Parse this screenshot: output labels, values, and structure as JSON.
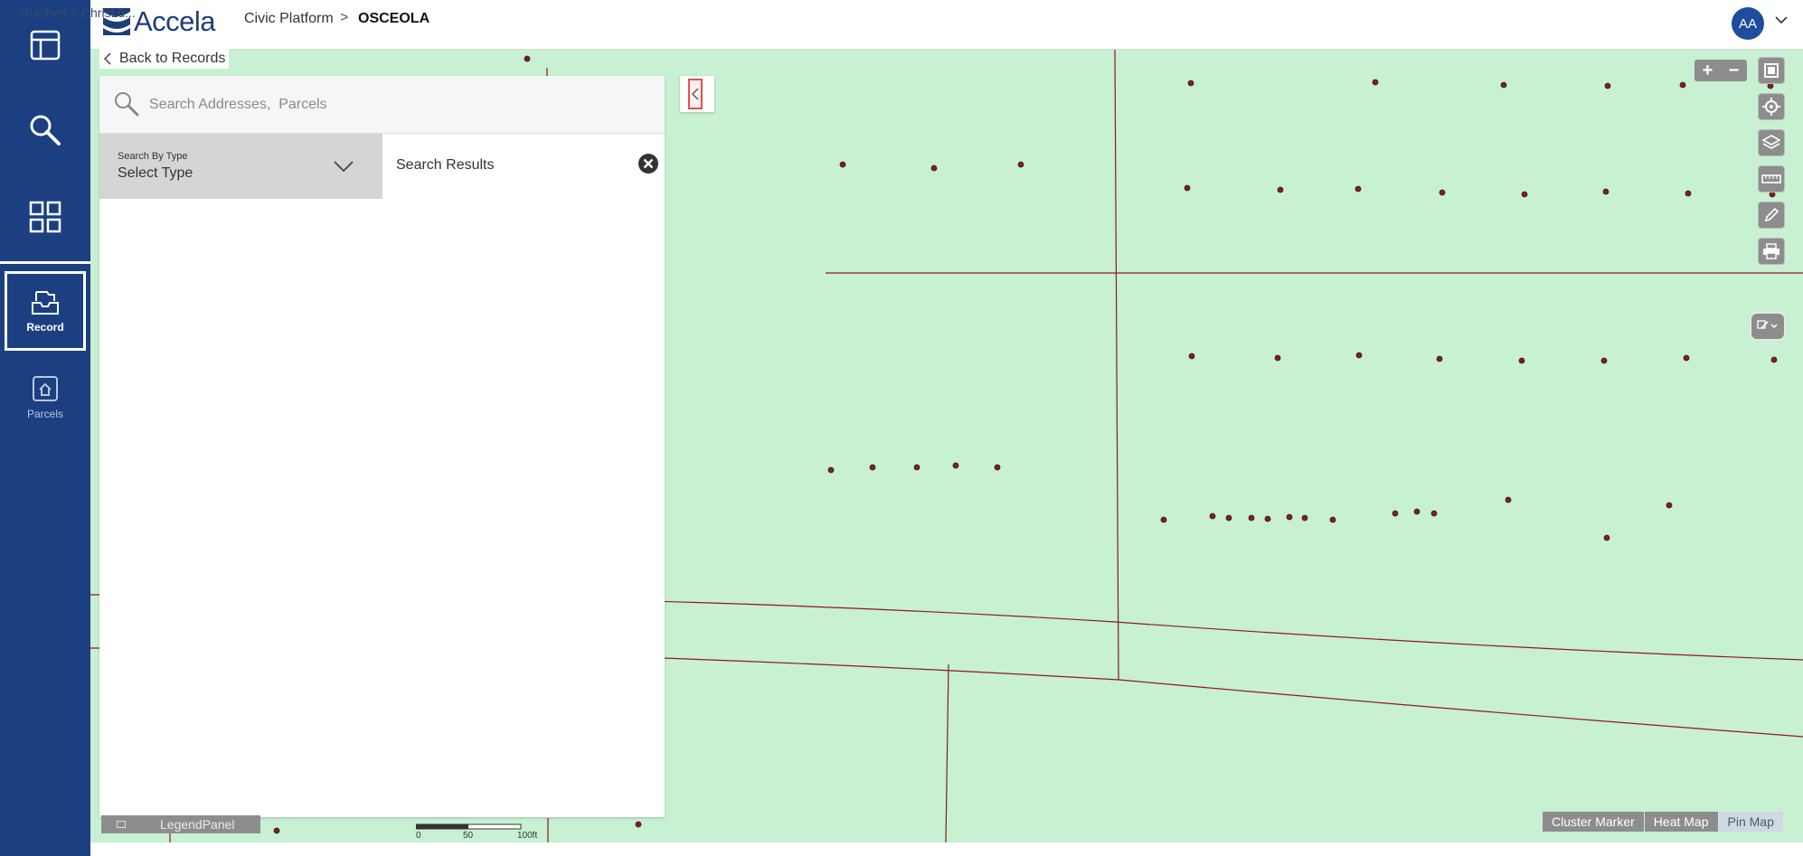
{
  "header": {
    "logo_text": "Accela",
    "breadcrumb_root": "Civic Platform",
    "breadcrumb_sep": ">",
    "breadcrumb_current": "OSCEOLA",
    "avatar_initials": "AA",
    "ghost_breadcrumb": "TruChen > ChrisLu..."
  },
  "leftnav": {
    "items": [
      {
        "name": "dashboard",
        "icon": "layout-icon",
        "label": ""
      },
      {
        "name": "search",
        "icon": "search-icon",
        "label": ""
      },
      {
        "name": "apps",
        "icon": "grid-icon",
        "label": ""
      },
      {
        "name": "record",
        "icon": "inbox-icon",
        "label": "Record"
      },
      {
        "name": "parcels",
        "icon": "parcel-icon",
        "label": "Parcels"
      }
    ]
  },
  "back_link": "Back to Records",
  "search": {
    "placeholder": "Search Addresses,  Parcels",
    "value": "",
    "type_small_label": "Search By Type",
    "type_value": "Select Type",
    "results_label": "Search Results"
  },
  "bottom": {
    "legend_label": "LegendPanel",
    "scale_ticks": [
      "0",
      "50",
      "100ft"
    ],
    "modes": [
      {
        "label": "Cluster Marker",
        "active": false
      },
      {
        "label": "Heat Map",
        "active": false
      },
      {
        "label": "Pin Map",
        "active": true
      }
    ]
  },
  "colors": {
    "nav_bg": "#1b3f80",
    "map_bg": "#c8f0d2",
    "parcel_line": "#8b1a1a",
    "point_fill": "#8b1a1a",
    "tool_gray": "#8d8d8d"
  }
}
